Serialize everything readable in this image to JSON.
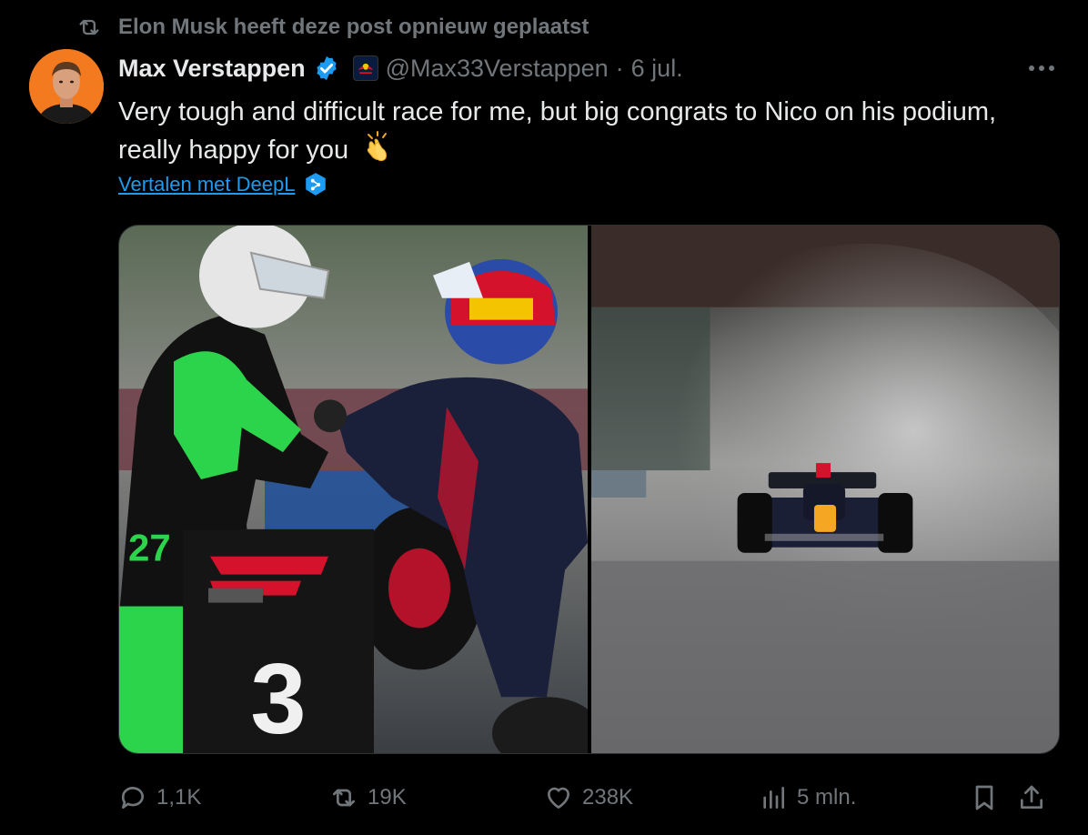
{
  "repost_banner": {
    "text": "Elon Musk heeft deze post opnieuw geplaatst",
    "icon": "repost-icon"
  },
  "author": {
    "name": "Max Verstappen",
    "handle": "@Max33Verstappen",
    "separator": "·",
    "date": "6 jul.",
    "verified_icon": "verified-badge-icon",
    "affiliate_icon": "red-bull-racing-affiliate-icon"
  },
  "tweet": {
    "text": "Very tough and difficult race for me, but big congrats to Nico on his podium, really happy for you",
    "emoji": "👏",
    "translate_label": "Vertalen met DeepL"
  },
  "media": {
    "images": [
      "podium-handshake-photo",
      "wet-race-car-photo"
    ],
    "left_photo_text": {
      "f1_board": "3",
      "driver_number": "27"
    }
  },
  "actions": {
    "replies": "1,1K",
    "reposts": "19K",
    "likes": "238K",
    "views": "5 mln."
  },
  "colors": {
    "background": "#000000",
    "text": "#e7e9ea",
    "muted": "#71767b",
    "link": "#1d9bf0",
    "verified": "#1d9bf0"
  }
}
